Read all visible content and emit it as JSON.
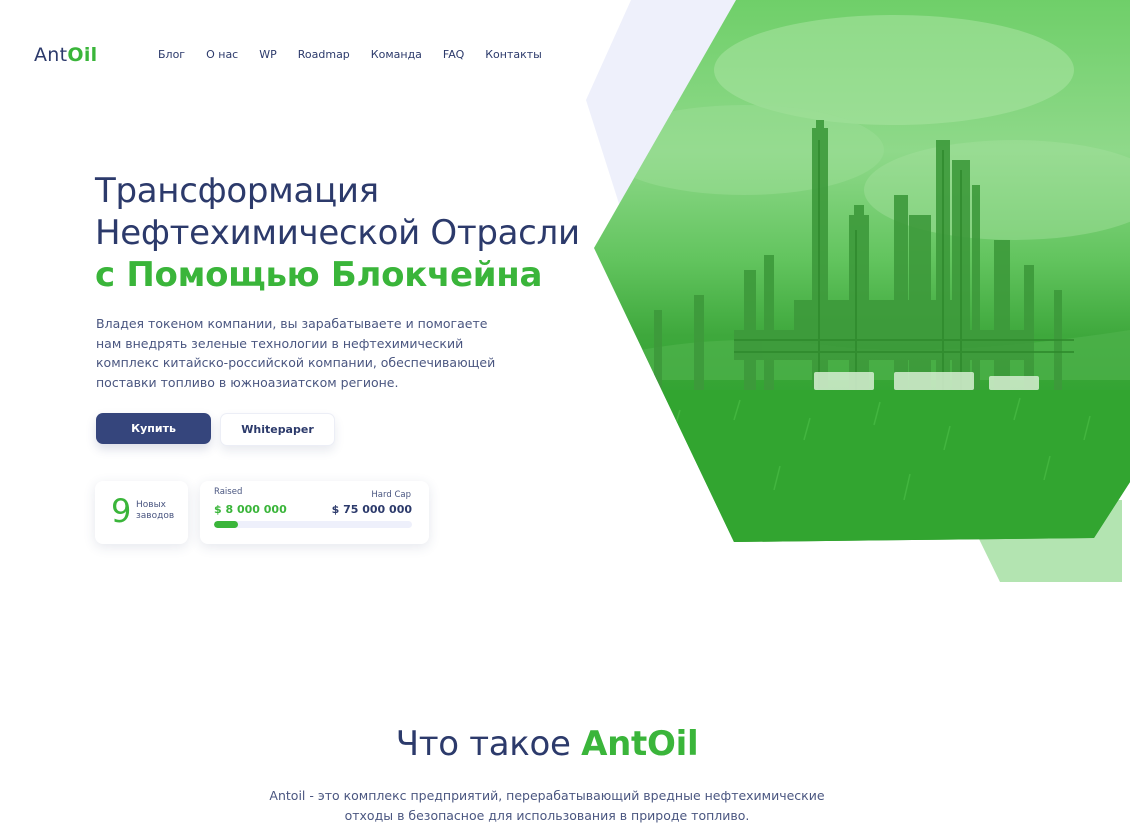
{
  "brand": {
    "logo_part_a": "Ant",
    "logo_part_b": "Oil"
  },
  "nav": {
    "items": [
      {
        "label": "Блог"
      },
      {
        "label": "О нас"
      },
      {
        "label": "WP"
      },
      {
        "label": "Roadmap"
      },
      {
        "label": "Команда"
      },
      {
        "label": "FAQ"
      },
      {
        "label": "Контакты"
      }
    ]
  },
  "hero": {
    "title_line1": "Трансформация",
    "title_line2": "Нефтехимической Отрасли",
    "title_line3": "с Помощью Блокчейна",
    "description": "Владея токеном компании, вы зарабатываете и помогаете нам внедрять зеленые технологии в нефтехимический комплекс китайско-российской компании, обеспечивающей поставки топливо в южноазиатском регионе.",
    "buy_label": "Купить",
    "whitepaper_label": "Whitepaper",
    "image_icon": "refinery-photo"
  },
  "stats": {
    "plants_count": "9",
    "plants_label": "Новых заводов",
    "raised_label": "Raised",
    "raised_value": "$ 8 000 000",
    "hardcap_label": "Hard Cap",
    "hardcap_value": "$ 75 000 000",
    "progress_fraction": 0.12
  },
  "about": {
    "title_part_a": "Что такое ",
    "title_part_b": "AntOil",
    "description": "Antoil - это комплекс предприятий, перерабатывающий вредные нефтехимические отходы в безопасное для использования в природе топливо."
  },
  "colors": {
    "primary_navy": "#35457c",
    "text_navy": "#2c3a6b",
    "accent_green": "#3ab53a",
    "light_lavender": "#eef0fb",
    "light_green": "#b3e4b1"
  }
}
